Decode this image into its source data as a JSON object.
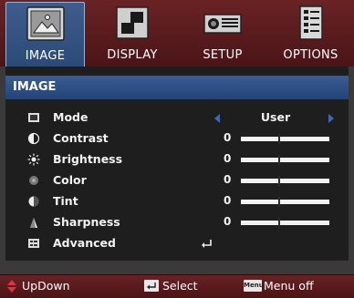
{
  "tabs": [
    {
      "label": "IMAGE",
      "icon": "image-icon",
      "active": true
    },
    {
      "label": "DISPLAY",
      "icon": "display-icon",
      "active": false
    },
    {
      "label": "SETUP",
      "icon": "setup-icon",
      "active": false
    },
    {
      "label": "OPTIONS",
      "icon": "options-icon",
      "active": false
    }
  ],
  "section": {
    "title": "IMAGE"
  },
  "items": [
    {
      "label": "Mode",
      "icon": "mode-icon",
      "value": "User"
    },
    {
      "label": "Contrast",
      "icon": "contrast-icon",
      "value": "0",
      "slider_fraction": 0.42
    },
    {
      "label": "Brightness",
      "icon": "brightness-icon",
      "value": "0",
      "slider_fraction": 0.42
    },
    {
      "label": "Color",
      "icon": "color-icon",
      "value": "0",
      "slider_fraction": 0.42
    },
    {
      "label": "Tint",
      "icon": "tint-icon",
      "value": "0",
      "slider_fraction": 0.42
    },
    {
      "label": "Sharpness",
      "icon": "sharpness-icon",
      "value": "0",
      "slider_fraction": 0.42
    },
    {
      "label": "Advanced",
      "icon": "advanced-icon"
    }
  ],
  "footer": {
    "updown": "UpDown",
    "select": "Select",
    "menu_key": "Menu",
    "menu_off": "Menu off"
  },
  "colors": {
    "tabbar": "#5a1c1f",
    "accent_blue": "#2c4a78",
    "panel": "#1e1e1e",
    "footer_arrow": "#e0333c"
  }
}
